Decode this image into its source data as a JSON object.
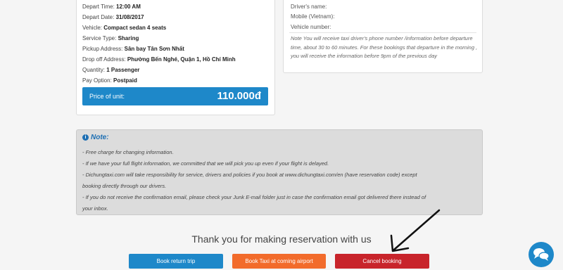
{
  "booking": {
    "depart_time_label": "Depart Time:",
    "depart_time": "12:00 AM",
    "depart_date_label": "Depart Date:",
    "depart_date": "31/08/2017",
    "vehicle_label": "Vehicle:",
    "vehicle": "Compact sedan 4 seats",
    "service_type_label": "Service Type:",
    "service_type": "Sharing",
    "pickup_label": "Pickup Address:",
    "pickup": "Sân bay Tân Sơn Nhất",
    "dropoff_label": "Drop off Address:",
    "dropoff": "Phường Bến Nghé, Quận 1, Hồ Chí Minh",
    "quantity_label": "Quantity:",
    "quantity": "1 Passenger",
    "pay_option_label": "Pay Option:",
    "pay_option": "Postpaid",
    "price_label": "Price of unit:",
    "price": "110.000đ"
  },
  "driver": {
    "name_label": "Driver's name:",
    "mobile_label": "Mobile (Vietnam):",
    "vehicle_number_label": "Vehicle number:",
    "note": "Note You will receive taxi driver's phone number /information before departure time, about 30 to 60 minutes. For these bookings that departure in the morning , you will receive the information before 9pm of the previous day"
  },
  "note_box": {
    "title": "Note:",
    "line1": "- Free charge for changing information.",
    "line2": "- If we have your full flight information, we committed that we will pick you up even if your flight is delayed.",
    "line3": "- Dichungtaxi.com will take responsibility for service, drivers and policies if you book at www.dichungtaxi.com/en (have reservation code) except",
    "line4": "booking directly through our drivers.",
    "line5": "- If you do not receive the confirmation email, please check your Junk E-mail folder just in case the confirmation email got delivered there instead of",
    "line6": "your inbox."
  },
  "thanks": "Thank you for making reservation with us",
  "buttons": {
    "return_trip": "Book return trip",
    "coming_airport": "Book Taxi at coming airport",
    "cancel": "Cancel booking"
  },
  "colors": {
    "primary_blue": "#1e88c9",
    "orange": "#f26b2b",
    "red": "#c8242b"
  },
  "icons": {
    "info": "info-icon",
    "chat": "chat-icon"
  }
}
